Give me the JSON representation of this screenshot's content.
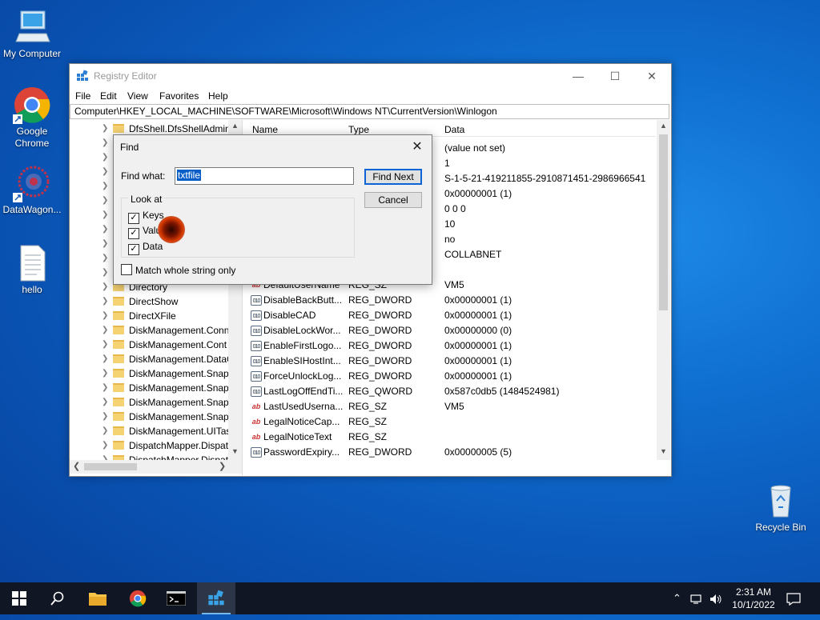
{
  "desktop": {
    "icons": [
      {
        "label": "My Computer"
      },
      {
        "label": "Google Chrome"
      },
      {
        "label": "DataWagon..."
      },
      {
        "label": "hello"
      },
      {
        "label": "Recycle Bin"
      }
    ]
  },
  "regedit": {
    "title": "Registry Editor",
    "menu": [
      "File",
      "Edit",
      "View",
      "Favorites",
      "Help"
    ],
    "address": "Computer\\HKEY_LOCAL_MACHINE\\SOFTWARE\\Microsoft\\Windows NT\\CurrentVersion\\Winlogon",
    "tree": [
      "DfsShell.DfsShellAdmin",
      "Directory",
      "DirectShow",
      "DirectXFile",
      "DiskManagement.Conn",
      "DiskManagement.Cont",
      "DiskManagement.DataO",
      "DiskManagement.Snap",
      "DiskManagement.Snap",
      "DiskManagement.Snap",
      "DiskManagement.Snap",
      "DiskManagement.UITas",
      "DispatchMapper.Dispat",
      "DispatchMapper.Dispat"
    ],
    "columns": {
      "name": "Name",
      "type": "Type",
      "data": "Data"
    },
    "top_data": [
      "(value not set)",
      "1",
      "S-1-5-21-419211855-2910871451-2986966541",
      "0x00000001 (1)",
      "0 0 0",
      "10",
      "no",
      "COLLABNET"
    ],
    "rows": [
      {
        "name": "DefaultUserName",
        "type": "REG_SZ",
        "data": "VM5",
        "icon": "string"
      },
      {
        "name": "DisableBackButt...",
        "type": "REG_DWORD",
        "data": "0x00000001 (1)",
        "icon": "binary"
      },
      {
        "name": "DisableCAD",
        "type": "REG_DWORD",
        "data": "0x00000001 (1)",
        "icon": "binary"
      },
      {
        "name": "DisableLockWor...",
        "type": "REG_DWORD",
        "data": "0x00000000 (0)",
        "icon": "binary"
      },
      {
        "name": "EnableFirstLogo...",
        "type": "REG_DWORD",
        "data": "0x00000001 (1)",
        "icon": "binary"
      },
      {
        "name": "EnableSIHostInt...",
        "type": "REG_DWORD",
        "data": "0x00000001 (1)",
        "icon": "binary"
      },
      {
        "name": "ForceUnlockLog...",
        "type": "REG_DWORD",
        "data": "0x00000001 (1)",
        "icon": "binary"
      },
      {
        "name": "LastLogOffEndTi...",
        "type": "REG_QWORD",
        "data": "0x587c0db5 (1484524981)",
        "icon": "binary"
      },
      {
        "name": "LastUsedUserna...",
        "type": "REG_SZ",
        "data": "VM5",
        "icon": "string"
      },
      {
        "name": "LegalNoticeCap...",
        "type": "REG_SZ",
        "data": "",
        "icon": "string"
      },
      {
        "name": "LegalNoticeText",
        "type": "REG_SZ",
        "data": "",
        "icon": "string"
      },
      {
        "name": "PasswordExpiry...",
        "type": "REG_DWORD",
        "data": "0x00000005 (5)",
        "icon": "binary"
      }
    ]
  },
  "find": {
    "title": "Find",
    "find_what_label": "Find what:",
    "find_what_value": "txtfile",
    "find_next": "Find Next",
    "cancel": "Cancel",
    "look_at": "Look at",
    "keys": "Keys",
    "values": "Values",
    "data": "Data",
    "match_whole": "Match whole string only"
  },
  "taskbar": {
    "time": "2:31 AM",
    "date": "10/1/2022"
  }
}
